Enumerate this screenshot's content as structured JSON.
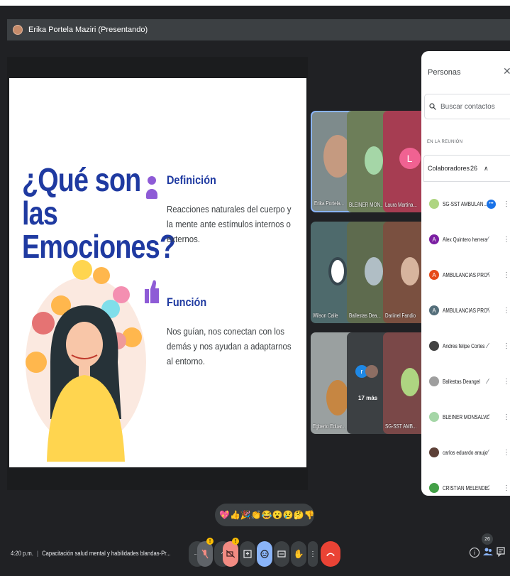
{
  "header": {
    "presenter_label": "Erika Portela Maziri (Presentando)"
  },
  "slide": {
    "title": "¿Qué son las Emociones?",
    "def_heading": "Definición",
    "def_text": "Reacciones naturales del cuerpo y la mente ante estímulos internos o externos.",
    "func_heading": "Función",
    "func_text": "Nos guían, nos conectan con los demás y nos ayudan a adaptarnos al entorno."
  },
  "tiles": [
    {
      "label": "Erika Portela..."
    },
    {
      "label": "BLEINER MON..."
    },
    {
      "label": "Laura Martina...",
      "initial": "L"
    },
    {
      "label": "Wilson Calle"
    },
    {
      "label": "Ballestas Dea..."
    },
    {
      "label": "Dariinel Fandio"
    },
    {
      "label": "Egberto Eduar..."
    },
    {
      "label": "17 más",
      "initial": "r"
    },
    {
      "label": "SG-SST AMB..."
    }
  ],
  "people_panel": {
    "title": "Personas",
    "search_placeholder": "Buscar contactos",
    "section_label": "EN LA REUNIÓN",
    "group_label": "Colaboradores",
    "group_count": "26",
    "participants": [
      {
        "name": "SG-SST AMBULAN... (Tú)"
      },
      {
        "name": "Alex Quintero herrera",
        "initial": "A"
      },
      {
        "name": "AMBULANCIAS PROYE...",
        "initial": "A"
      },
      {
        "name": "AMBULANCIAS PROYE...",
        "initial": "A"
      },
      {
        "name": "Andres felipe Cortes"
      },
      {
        "name": "Ballestas Deangel"
      },
      {
        "name": "BLEINER MONSALVO BA"
      },
      {
        "name": "carlos eduardo araujo ..."
      },
      {
        "name": "CRISTIAN MELENDEZ"
      }
    ]
  },
  "reactions": [
    "💖",
    "👍",
    "🎉",
    "👏",
    "😂",
    "😮",
    "😢",
    "🤔",
    "👎"
  ],
  "bottom": {
    "time": "4:20 p.m.",
    "meeting_title": "Capacitación salud mental y habilidades blandas-Pr...",
    "people_count": "26",
    "mic_badge": "!",
    "cam_badge": "!"
  }
}
